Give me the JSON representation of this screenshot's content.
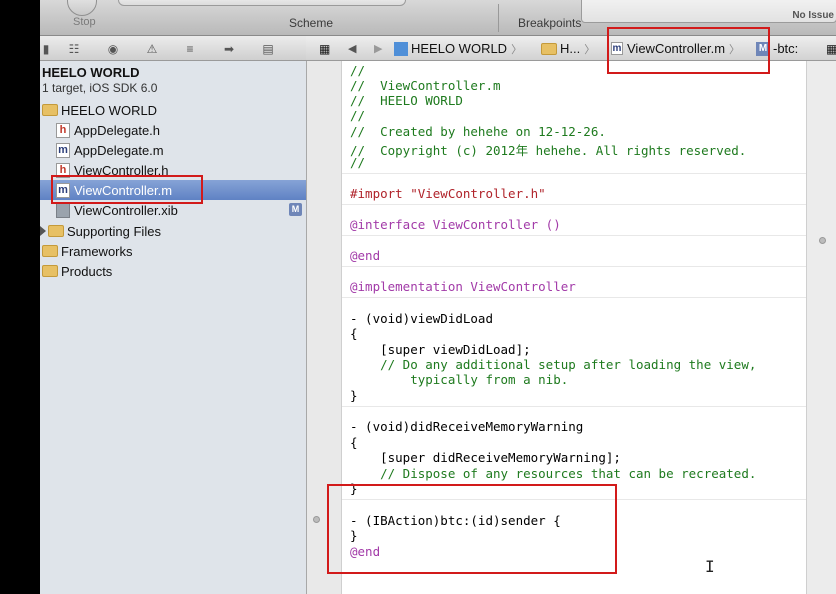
{
  "toolbar": {
    "stop_label": "Stop",
    "scheme_label": "Scheme",
    "breakpoints_label": "Breakpoints",
    "issues_label": "No Issue"
  },
  "navigator": {
    "project_title": "HEELO WORLD",
    "project_subtitle": "1 target, iOS SDK 6.0",
    "items": [
      {
        "label": "HEELO WORLD",
        "icon": "folder-icon"
      },
      {
        "label": "AppDelegate.h",
        "icon": "h-file-icon"
      },
      {
        "label": "AppDelegate.m",
        "icon": "m-file-icon"
      },
      {
        "label": "ViewController.h",
        "icon": "h-file-icon"
      },
      {
        "label": "ViewController.m",
        "icon": "m-file-icon"
      },
      {
        "label": "ViewController.xib",
        "icon": "xib-file-icon",
        "badge": "M"
      },
      {
        "label": "Supporting Files",
        "icon": "folder-icon"
      },
      {
        "label": "Frameworks",
        "icon": "folder-icon"
      },
      {
        "label": "Products",
        "icon": "folder-icon"
      }
    ]
  },
  "jumpbar": {
    "project": "HEELO WORLD",
    "group": "H...",
    "file": "ViewController.m",
    "symbol_badge": "M",
    "symbol": "-btc:"
  },
  "code": {
    "lines": [
      "//",
      "//  ViewController.m",
      "//  HEELO WORLD",
      "//",
      "//  Created by hehehe on 12-12-26.",
      "//  Copyright (c) 2012年 hehehe. All rights reserved.",
      "//",
      "#import \"ViewController.h\"",
      "@interface ViewController ()",
      "@end",
      "@implementation ViewController",
      "- (void)viewDidLoad",
      "{",
      "    [super viewDidLoad];",
      "    // Do any additional setup after loading the view,",
      "        typically from a nib.",
      "}",
      "- (void)didReceiveMemoryWarning",
      "{",
      "    [super didReceiveMemoryWarning];",
      "    // Dispose of any resources that can be recreated.",
      "}",
      "- (IBAction)btc:(id)sender {",
      "}",
      "@end"
    ]
  },
  "colors": {
    "comment": "#1e7a1e",
    "keyword": "#a23aa8",
    "string": "#b0232a",
    "highlight_box": "#d21a1a",
    "selection": "#5f82c4"
  }
}
